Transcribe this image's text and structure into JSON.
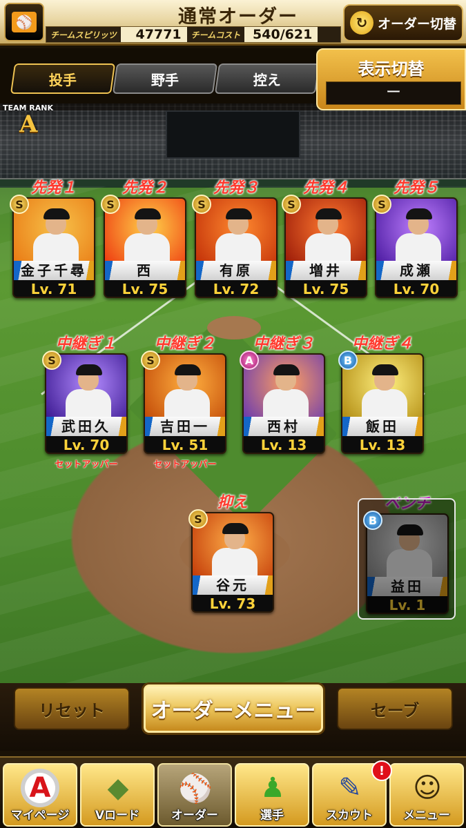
{
  "header": {
    "title": "通常オーダー",
    "team_spirits_label": "チームスピリッツ",
    "team_spirits_value": "47771",
    "team_cost_label": "チームコスト",
    "team_cost_value": "540/621",
    "switch_order_label": "オーダー切替",
    "logo_icon": "giants-logo-icon"
  },
  "tabs": [
    {
      "label": "投手",
      "active": true
    },
    {
      "label": "野手",
      "active": false
    },
    {
      "label": "控え",
      "active": false
    }
  ],
  "display_switch": {
    "title": "表示切替",
    "value": "ー"
  },
  "team_rank": {
    "label": "TEAM RANK",
    "grade": "A"
  },
  "starters": [
    {
      "slot": "先発１",
      "rank": "S",
      "name": "金子千尋",
      "level": "Lv. 71",
      "art": [
        "#f7c24a",
        "#e97a14"
      ]
    },
    {
      "slot": "先発２",
      "rank": "S",
      "name": "西",
      "level": "Lv. 75",
      "art": [
        "#ffd24a",
        "#ee3a10"
      ]
    },
    {
      "slot": "先発３",
      "rank": "S",
      "name": "有原",
      "level": "Lv. 72",
      "art": [
        "#ff8a30",
        "#c23008"
      ]
    },
    {
      "slot": "先発４",
      "rank": "S",
      "name": "増井",
      "level": "Lv. 75",
      "art": [
        "#ff7a30",
        "#9a1a08"
      ]
    },
    {
      "slot": "先発５",
      "rank": "S",
      "name": "成瀬",
      "level": "Lv. 70",
      "art": [
        "#c080ff",
        "#4a1aa0"
      ]
    }
  ],
  "relievers": [
    {
      "slot": "中継ぎ１",
      "rank": "S",
      "name": "武田久",
      "level": "Lv. 70",
      "note": "セットアッパー",
      "art": [
        "#b48cff",
        "#3a1890"
      ]
    },
    {
      "slot": "中継ぎ２",
      "rank": "S",
      "name": "吉田一",
      "level": "Lv. 51",
      "note": "セットアッパー",
      "art": [
        "#ffb040",
        "#c24a08"
      ]
    },
    {
      "slot": "中継ぎ３",
      "rank": "A",
      "name": "西村",
      "level": "Lv. 13",
      "note": "",
      "art": [
        "#ffa060",
        "#6a3ab0"
      ]
    },
    {
      "slot": "中継ぎ４",
      "rank": "B",
      "name": "飯田",
      "level": "Lv. 13",
      "note": "",
      "art": [
        "#fff080",
        "#b08a10"
      ]
    }
  ],
  "closer": {
    "slot": "抑え",
    "rank": "S",
    "name": "谷元",
    "level": "Lv. 73",
    "art": [
      "#ffb04a",
      "#c23a08"
    ]
  },
  "bench": {
    "slot": "ベンチ",
    "rank": "B",
    "name": "益田",
    "level": "Lv.  1",
    "art": [
      "#eeeeee",
      "#8a8a8a"
    ]
  },
  "actions": {
    "reset": "リセット",
    "order_menu": "オーダーメニュー",
    "save": "セーブ"
  },
  "nav": [
    {
      "label": "マイページ",
      "icon": "mypage-icon",
      "glyph": "A",
      "current": false
    },
    {
      "label": "Vロード",
      "icon": "v-road-icon",
      "glyph": "◆",
      "current": false
    },
    {
      "label": "オーダー",
      "icon": "order-field-icon",
      "glyph": "⚾",
      "current": true
    },
    {
      "label": "選手",
      "icon": "player-icon",
      "glyph": "♟",
      "current": false
    },
    {
      "label": "スカウト",
      "icon": "scout-icon",
      "glyph": "✎",
      "current": false,
      "badge": "!"
    },
    {
      "label": "メニュー",
      "icon": "menu-character-icon",
      "glyph": "☺",
      "current": false
    }
  ]
}
